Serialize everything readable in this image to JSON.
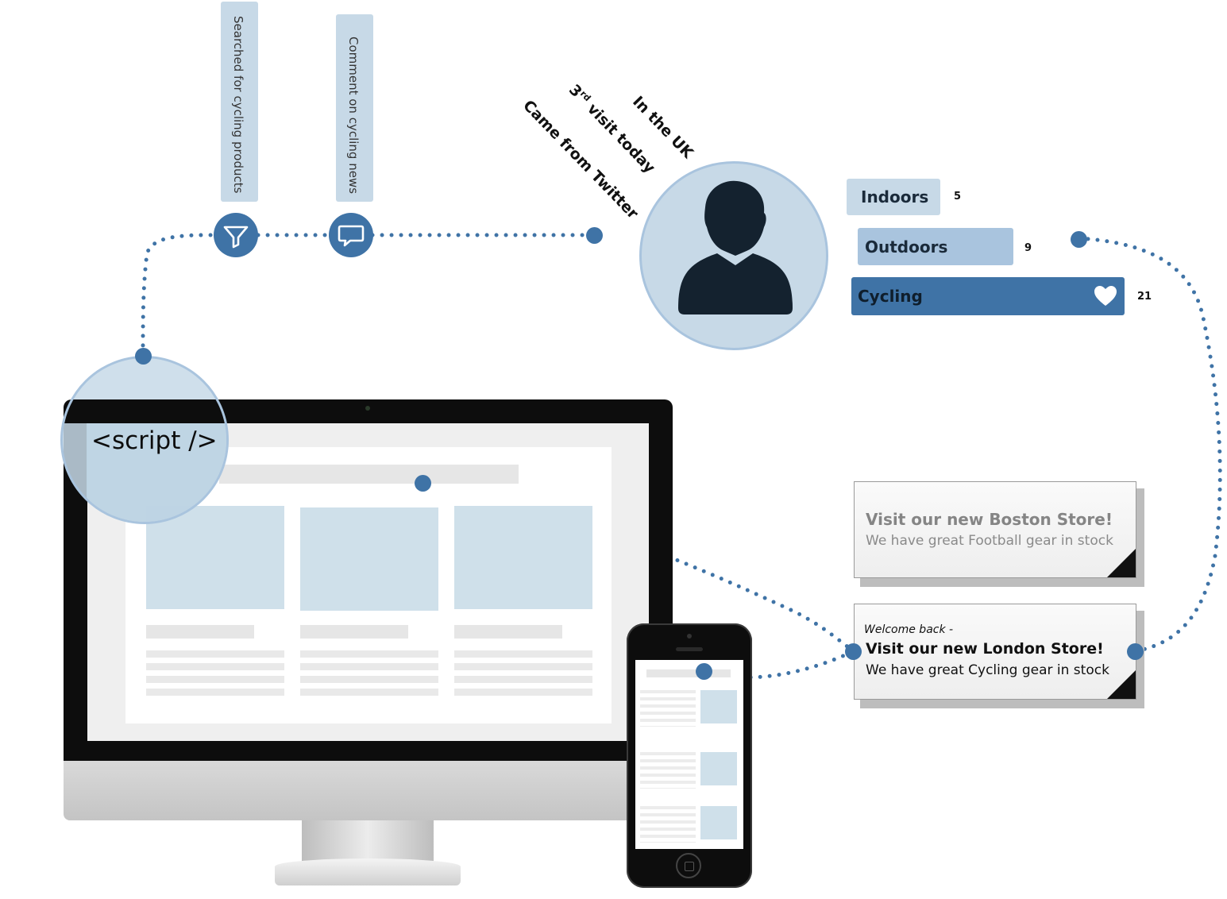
{
  "signals": {
    "searched_label": "Searched for cycling products",
    "comment_label": "Comment on cycling news",
    "came_from": "Came from Twitter",
    "visit_count": "3",
    "visit_sup": "rd",
    "visit_rest": " visit today",
    "location": "In the UK"
  },
  "interests": [
    {
      "label": "Indoors",
      "count": "5"
    },
    {
      "label": "Outdoors",
      "count": "9"
    },
    {
      "label": "Cycling",
      "count": "21"
    }
  ],
  "script_label": "<script />",
  "cards": {
    "boston": {
      "title": "Visit our new Boston Store!",
      "body": "We have great Football gear in stock"
    },
    "london": {
      "prefix": "Welcome back -",
      "title": "Visit our new London Store!",
      "body": "We have great Cycling gear in stock"
    }
  },
  "colors": {
    "accent": "#3f73a6",
    "light_blue": "#c7d9e7",
    "mid_blue": "#a9c4de",
    "dark_navy": "#14222f"
  },
  "icons": [
    "funnel-icon",
    "chat-bubble-icon",
    "user-avatar-icon",
    "heart-icon"
  ]
}
